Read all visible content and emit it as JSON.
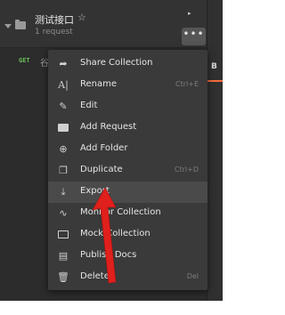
{
  "collection": {
    "name": "测试接口",
    "star_icon": "star-icon",
    "request_count": "1 request",
    "expand_arrow": "▸",
    "more_button": "•••"
  },
  "request": {
    "method": "GET",
    "name": "谷"
  },
  "right_panel": {
    "tab_letter": "B",
    "accent_color": "#f26b3a"
  },
  "menu": {
    "items": [
      {
        "label": "Share Collection",
        "icon": "share-icon",
        "shortcut": ""
      },
      {
        "label": "Rename",
        "icon": "rename-icon",
        "shortcut": "Ctrl+E"
      },
      {
        "label": "Edit",
        "icon": "pencil-icon",
        "shortcut": ""
      },
      {
        "label": "Add Request",
        "icon": "add-request-icon",
        "shortcut": ""
      },
      {
        "label": "Add Folder",
        "icon": "add-folder-icon",
        "shortcut": ""
      },
      {
        "label": "Duplicate",
        "icon": "duplicate-icon",
        "shortcut": "Ctrl+D"
      },
      {
        "label": "Export",
        "icon": "export-icon",
        "shortcut": ""
      },
      {
        "label": "Monitor Collection",
        "icon": "monitor-icon",
        "shortcut": ""
      },
      {
        "label": "Mock Collection",
        "icon": "mock-icon",
        "shortcut": ""
      },
      {
        "label": "Publish Docs",
        "icon": "docs-icon",
        "shortcut": ""
      },
      {
        "label": "Delete",
        "icon": "trash-icon",
        "shortcut": "Del"
      }
    ]
  },
  "annotation": {
    "arrow_color": "#e0201c"
  }
}
